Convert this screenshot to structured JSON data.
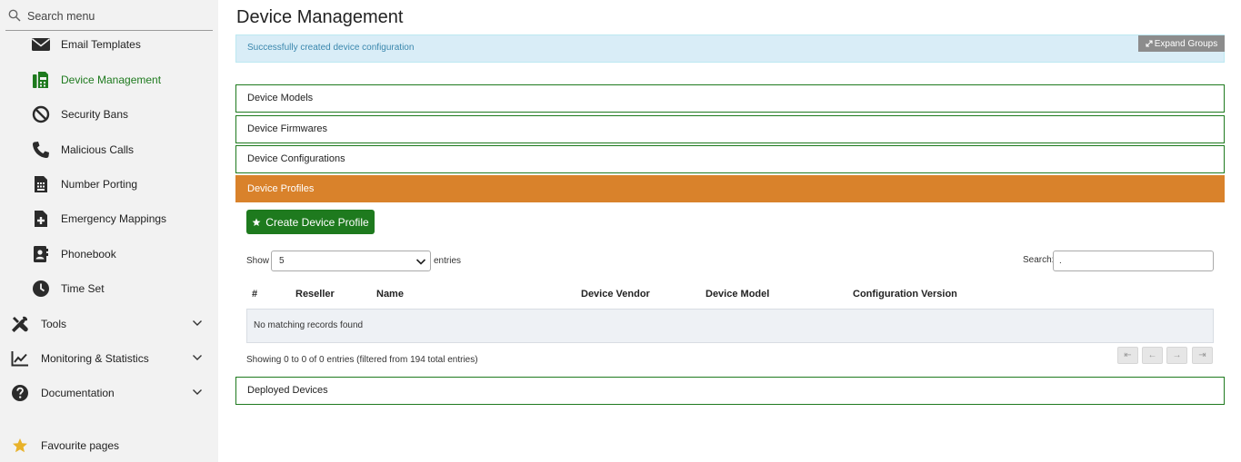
{
  "sidebar": {
    "search": {
      "placeholder": "Search menu",
      "value": ""
    },
    "items": [
      {
        "label": "Email Templates",
        "icon": "envelope-icon"
      },
      {
        "label": "Device Management",
        "icon": "fax-icon",
        "active": true
      },
      {
        "label": "Security Bans",
        "icon": "ban-icon"
      },
      {
        "label": "Malicious Calls",
        "icon": "phone-icon"
      },
      {
        "label": "Number Porting",
        "icon": "sim-card-icon"
      },
      {
        "label": "Emergency Mappings",
        "icon": "file-medical-icon"
      },
      {
        "label": "Phonebook",
        "icon": "address-book-icon"
      },
      {
        "label": "Time Set",
        "icon": "clock-icon"
      }
    ],
    "sections": [
      {
        "label": "Tools",
        "icon": "tools-icon"
      },
      {
        "label": "Monitoring & Statistics",
        "icon": "chart-line-icon"
      },
      {
        "label": "Documentation",
        "icon": "question-circle-icon"
      }
    ],
    "favourites": {
      "label": "Favourite pages",
      "icon": "star-icon"
    }
  },
  "main": {
    "title": "Device Management",
    "alert": "Successfully created device configuration",
    "expand_groups": "Expand Groups",
    "panels": {
      "models": "Device Models",
      "firmwares": "Device Firmwares",
      "configurations": "Device Configurations",
      "profiles": "Device Profiles",
      "deployed": "Deployed Devices"
    },
    "create_button": "Create Device Profile",
    "table": {
      "show_label": "Show",
      "show_value": "5",
      "entries_label": "entries",
      "search_label": "Search:",
      "search_value": ".",
      "columns": [
        "#",
        "Reseller",
        "Name",
        "Device Vendor",
        "Device Model",
        "Configuration Version"
      ],
      "empty_message": "No matching records found",
      "info": "Showing 0 to 0 of 0 entries (filtered from 194 total entries)",
      "pagination": [
        "⇤",
        "←",
        "→",
        "⇥"
      ]
    }
  },
  "colors": {
    "accent_green": "#1e7a1e",
    "active_panel": "#d9822b",
    "alert_bg": "#d9edf7",
    "alert_text": "#3a87ad"
  }
}
